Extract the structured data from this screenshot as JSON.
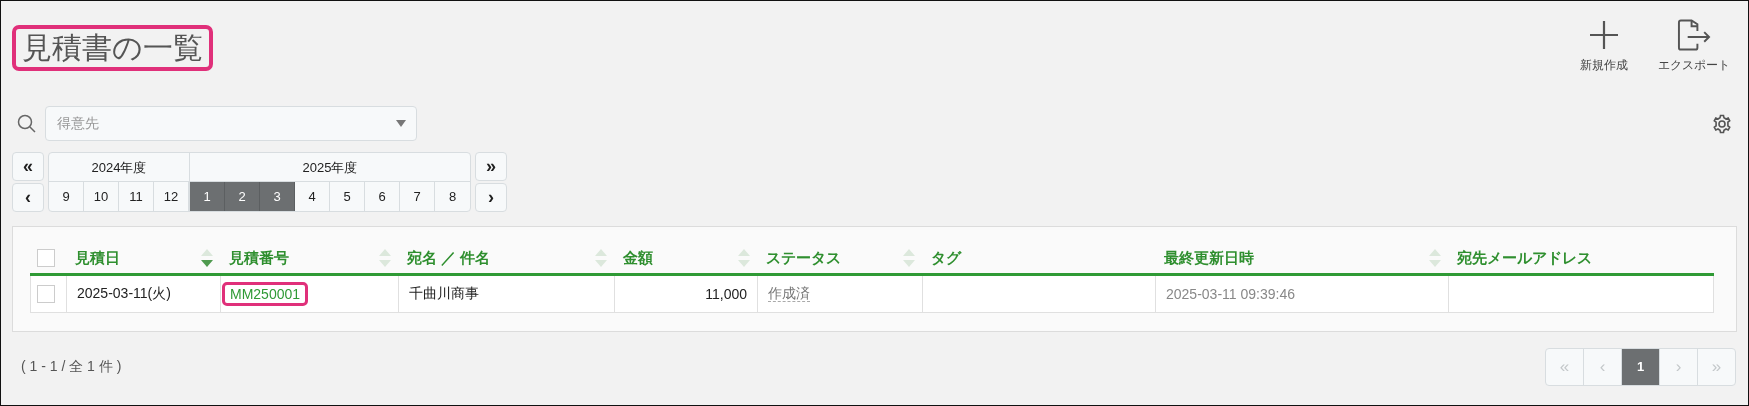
{
  "title": {
    "text": "見積書の一覧",
    "highlighted": true
  },
  "actions": [
    {
      "kind": "new",
      "label": "新規作成"
    },
    {
      "kind": "export",
      "label": "エクスポート"
    }
  ],
  "filter": {
    "placeholder": "得意先"
  },
  "period": {
    "prev_year": "«",
    "next_year": "»",
    "prev_month": "‹",
    "next_month": "›",
    "years": [
      {
        "label": "2024年度",
        "months": [
          {
            "label": "9",
            "selected": false
          },
          {
            "label": "10",
            "selected": false
          },
          {
            "label": "11",
            "selected": false
          },
          {
            "label": "12",
            "selected": false
          }
        ]
      },
      {
        "label": "2025年度",
        "months": [
          {
            "label": "1",
            "selected": true
          },
          {
            "label": "2",
            "selected": true
          },
          {
            "label": "3",
            "selected": true
          },
          {
            "label": "4",
            "selected": false
          },
          {
            "label": "5",
            "selected": false
          },
          {
            "label": "6",
            "selected": false
          },
          {
            "label": "7",
            "selected": false
          },
          {
            "label": "8",
            "selected": false
          }
        ]
      }
    ]
  },
  "table": {
    "select_all_checked": false,
    "columns": [
      {
        "label": "見積日",
        "sortable": true,
        "sorted": true
      },
      {
        "label": "見積番号",
        "sortable": true,
        "sorted": false
      },
      {
        "label": "宛名 ／ 件名",
        "sortable": true,
        "sorted": false
      },
      {
        "label": "金額",
        "sortable": true,
        "sorted": false
      },
      {
        "label": "ステータス",
        "sortable": true,
        "sorted": false
      },
      {
        "label": "タグ",
        "sortable": false,
        "sorted": false
      },
      {
        "label": "最終更新日時",
        "sortable": true,
        "sorted": false
      },
      {
        "label": "宛先メールアドレス",
        "sortable": false,
        "sorted": false
      }
    ],
    "rows": [
      {
        "checked": false,
        "cells": [
          {
            "kind": "text",
            "text": "2025-03-11(火)"
          },
          {
            "kind": "link",
            "text": "MM250001",
            "highlighted": true
          },
          {
            "kind": "text",
            "text": "千曲川商事"
          },
          {
            "kind": "number",
            "text": "11,000"
          },
          {
            "kind": "status",
            "text": "作成済"
          },
          {
            "kind": "empty"
          },
          {
            "kind": "muted",
            "text": "2025-03-11 09:39:46"
          },
          {
            "kind": "empty"
          }
        ]
      }
    ]
  },
  "summary": "( 1 - 1 / 全 1 件 )",
  "pager": [
    {
      "label": "«",
      "selected": false,
      "disabled": true
    },
    {
      "label": "‹",
      "selected": false,
      "disabled": true
    },
    {
      "label": "1",
      "selected": true,
      "disabled": false
    },
    {
      "label": "›",
      "selected": false,
      "disabled": true
    },
    {
      "label": "»",
      "selected": false,
      "disabled": true
    }
  ]
}
